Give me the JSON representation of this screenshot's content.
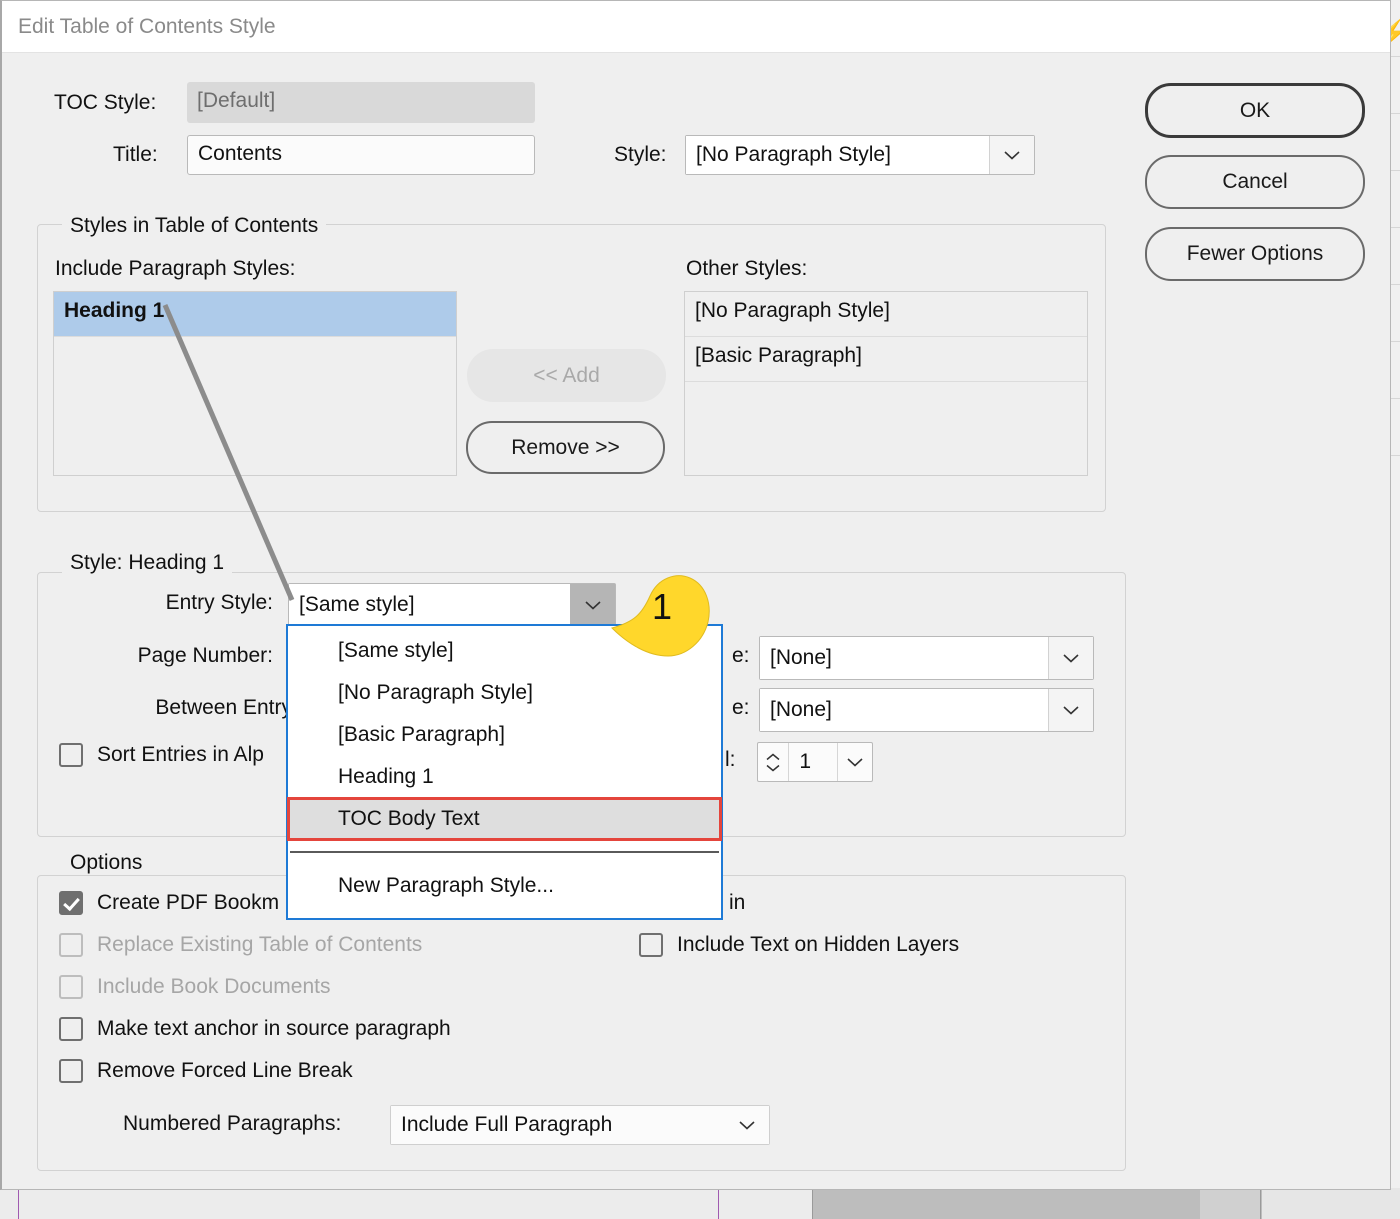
{
  "window": {
    "title": "Edit Table of Contents Style"
  },
  "top_fields": {
    "toc_style_label": "TOC Style:",
    "toc_style_value": "[Default]",
    "title_label": "Title:",
    "title_value": "Contents",
    "style_label": "Style:",
    "style_value": "[No Paragraph Style]"
  },
  "buttons": {
    "ok": "OK",
    "cancel": "Cancel",
    "fewer_options": "Fewer Options"
  },
  "styles_group": {
    "title": "Styles in Table of Contents",
    "include_label": "Include Paragraph Styles:",
    "other_label": "Other Styles:",
    "include_items": [
      "Heading 1"
    ],
    "other_items": [
      "[No Paragraph Style]",
      "[Basic Paragraph]"
    ],
    "add_button": "<< Add",
    "remove_button": "Remove >>"
  },
  "style_group": {
    "title": "Style: Heading 1",
    "entry_style_label": "Entry Style:",
    "entry_style_value": "[Same style]",
    "page_number_label": "Page Number:",
    "page_number_style_label": "e:",
    "page_number_style_value": "[None]",
    "between_entry_label": "Between Entry",
    "between_entry_style_label": "e:",
    "between_entry_style_value": "[None]",
    "sort_entries_label": "Sort Entries in Alp",
    "level_label": "l:",
    "level_value": "1"
  },
  "entry_style_dropdown": {
    "items": [
      "[Same style]",
      "[No Paragraph Style]",
      "[Basic Paragraph]",
      "Heading 1",
      "TOC Body Text"
    ],
    "highlighted": "TOC Body Text",
    "new_style_item": "New Paragraph Style..."
  },
  "options_group": {
    "title": "Options",
    "create_pdf_bookmarks": "Create PDF Bookm",
    "create_pdf_bookmarks_tail": "in",
    "replace_existing_toc": "Replace Existing Table of Contents",
    "include_book_documents": "Include Book Documents",
    "make_text_anchor": "Make text anchor in source paragraph",
    "remove_forced_line_break": "Remove Forced Line Break",
    "include_hidden_layers": "Include Text on Hidden Layers",
    "numbered_paragraphs_label": "Numbered Paragraphs:",
    "numbered_paragraphs_value": "Include Full Paragraph"
  },
  "annotations": {
    "callout_number": "1",
    "callout_color": "#FFD72B",
    "highlight_color": "#E4453C",
    "focus_color": "#1E7AD6",
    "selection_color": "#AECBEA"
  }
}
